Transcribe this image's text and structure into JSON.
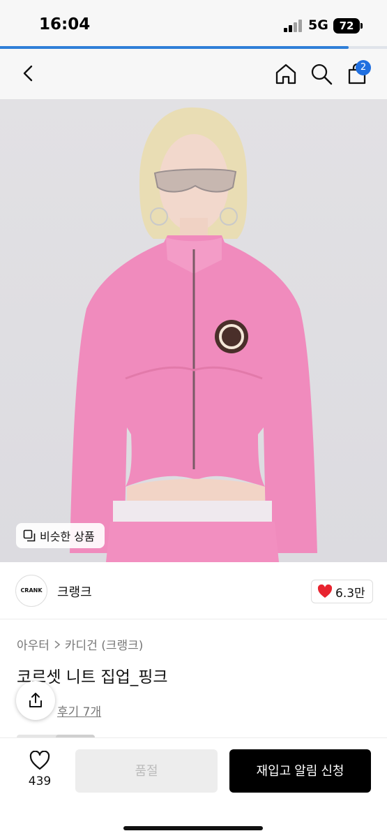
{
  "status_bar": {
    "time": "16:04",
    "network": "5G",
    "battery": "72"
  },
  "page_load_progress": 0.9,
  "nav": {
    "cart_count": "2"
  },
  "photo": {
    "similar_products_label": "비슷한 상품"
  },
  "brand": {
    "logo_text": "CRANK",
    "name": "크랭크",
    "likes": "6.3만",
    "like_color": "#e8242f"
  },
  "product": {
    "breadcrumb": [
      "아우터",
      "카디건 (크랭크)"
    ],
    "title": "코르셋 니트 집업_핑크",
    "review_link": "후기 7개"
  },
  "actions": {
    "wish_count": "439",
    "soldout_label": "품절",
    "restock_label": "재입고 알림 신청"
  },
  "colors": {
    "accent": "#1f6fe0",
    "jacket_pink": "#f08bbd"
  }
}
